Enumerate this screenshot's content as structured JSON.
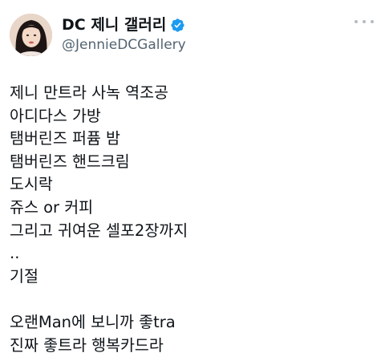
{
  "tweet": {
    "display_name": "DC 제니 갤러리",
    "handle": "@JennieDCGallery",
    "verified_icon": "verified-badge-icon",
    "more_icon": "more-options-icon",
    "lines": [
      "제니 만트라 사녹 역조공",
      "아디다스 가방",
      "탬버린즈 퍼퓸 밤",
      "탬버린즈 핸드크림",
      "도시락",
      "쥬스 or 커피",
      "그리고 귀여운 셀포2장까지",
      "..",
      "기절",
      "",
      "오랜Man에 보니까 좋tra",
      "진짜 좋트라 행복카드라"
    ]
  },
  "colors": {
    "text": "#0f1419",
    "secondary": "#536471",
    "verified": "#1d9bf0",
    "background": "#ffffff"
  }
}
